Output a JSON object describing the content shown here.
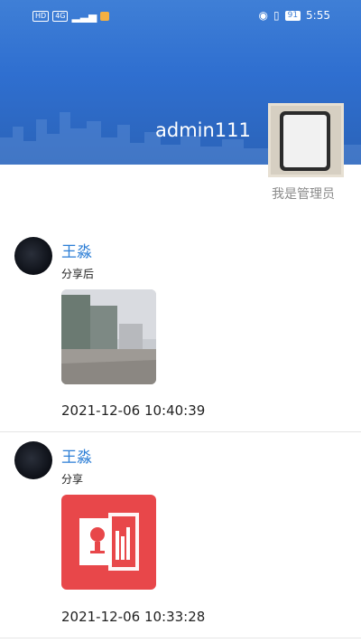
{
  "status_bar": {
    "left_tags": [
      "HD",
      "4G"
    ],
    "battery": "91",
    "time": "5:55"
  },
  "profile": {
    "username": "admin111",
    "role": "我是管理员"
  },
  "posts": [
    {
      "name": "王淼",
      "text": "分享后",
      "time": "2021-12-06 10:40:39",
      "media": "photo"
    },
    {
      "name": "王淼",
      "text": "分享",
      "time": "2021-12-06 10:33:28",
      "media": "audio-document-icon"
    }
  ],
  "colors": {
    "header": "#2f6fd0",
    "name": "#2c7ed6",
    "media_red": "#e8474a"
  }
}
